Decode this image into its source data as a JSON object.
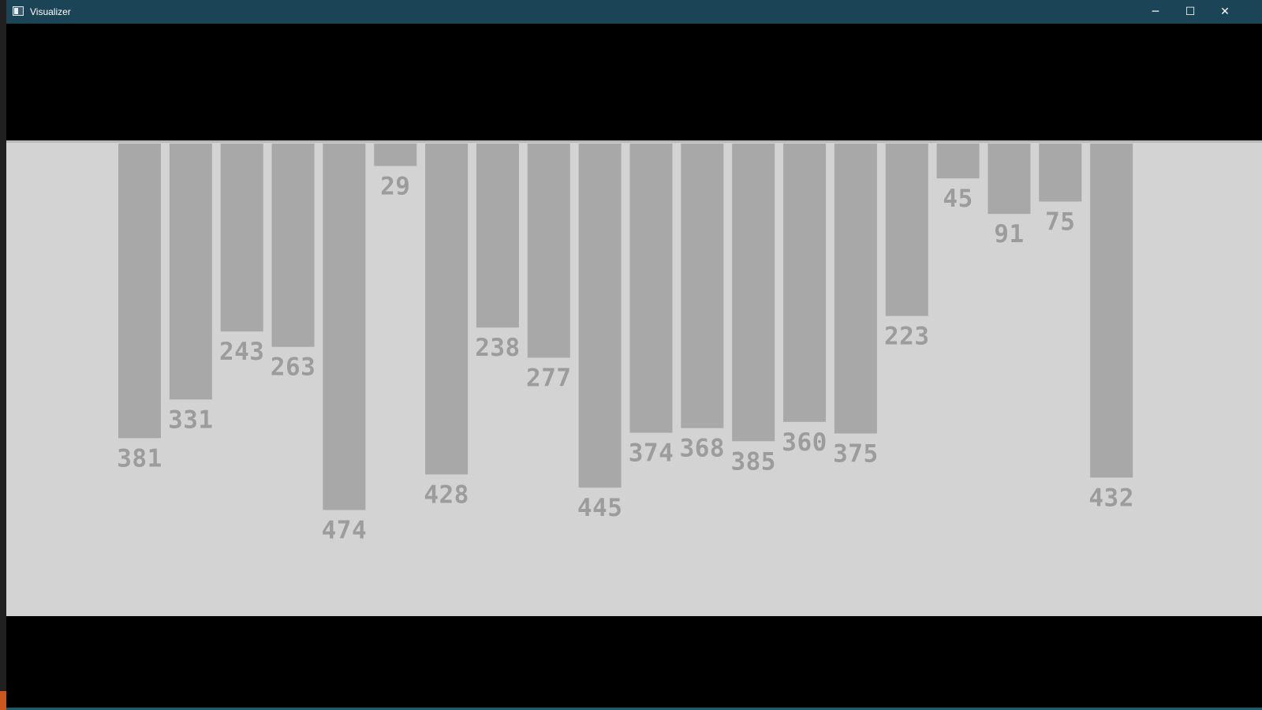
{
  "window": {
    "title": "Visualizer",
    "controls": {
      "minimize": "─",
      "maximize": "☐",
      "close": "✕"
    },
    "icon": "app-window-icon"
  },
  "colors": {
    "titlebar": "#1c4457",
    "window_background": "#000000",
    "visualizer_background": "#d3d3d3",
    "bar_fill": "#a8a8a8",
    "label_text": "#9c9c9c"
  },
  "chart_data": {
    "type": "bar",
    "orientation": "downward",
    "values": [
      381,
      331,
      243,
      263,
      474,
      29,
      428,
      238,
      277,
      445,
      374,
      368,
      385,
      360,
      375,
      223,
      45,
      91,
      75,
      432
    ],
    "labels": [
      "381",
      "331",
      "243",
      "263",
      "474",
      "29",
      "428",
      "238",
      "277",
      "445",
      "374",
      "368",
      "385",
      "360",
      "375",
      "223",
      "45",
      "91",
      "75",
      "432"
    ]
  }
}
